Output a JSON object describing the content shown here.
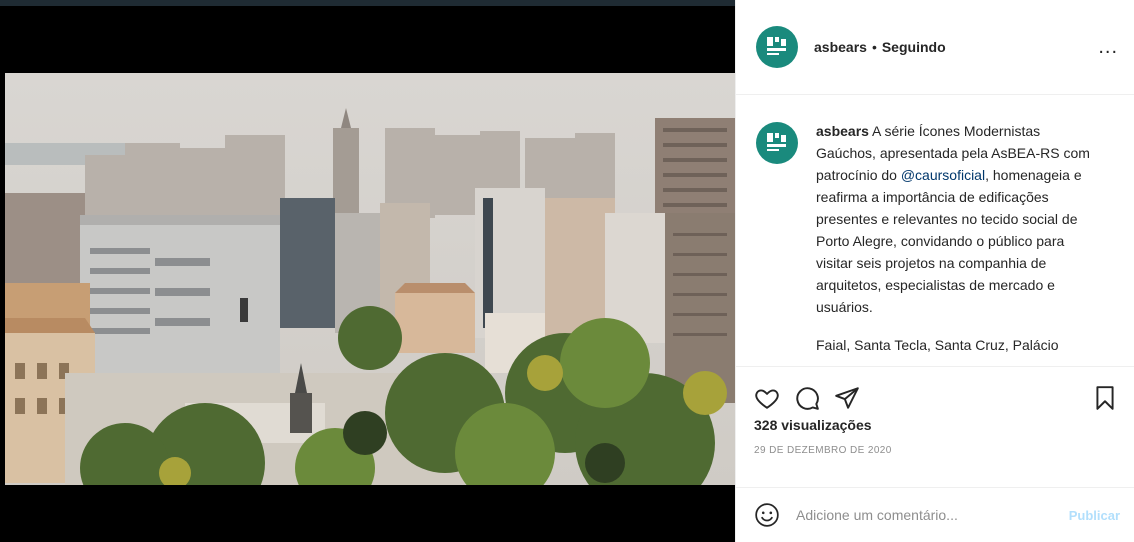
{
  "post": {
    "username": "asbears",
    "separator": "•",
    "follow_status": "Seguindo",
    "more_label": "...",
    "caption_paragraphs": [
      {
        "before": " A série Ícones Modernistas Gaúchos, apresentada pela AsBEA-RS com patrocínio do ",
        "mention": "@caursoficial",
        "after": ", homenageia e reafirma a importância de edificações presentes e relevantes no tecido social de Porto Alegre, convidando o público para visitar seis projetos na companhia de arquitetos, especialistas de mercado e usuários."
      },
      {
        "text": "Faial, Santa Tecla, Santa Cruz, Palácio"
      }
    ],
    "views": "328 visualizações",
    "date": "29 DE DEZEMBRO DE 2020"
  },
  "comment": {
    "placeholder": "Adicione um comentário...",
    "publish_label": "Publicar"
  },
  "icons": {
    "like": "heart-icon",
    "comment": "comment-icon",
    "share": "share-icon",
    "save": "bookmark-icon",
    "emoji": "emoji-icon",
    "mute": "speaker-muted-icon",
    "more": "more-options-icon"
  },
  "colors": {
    "brand_avatar": "#1a8a7d",
    "mention": "#00376b",
    "publish_disabled": "#b2dffc",
    "divider": "#efefef"
  }
}
